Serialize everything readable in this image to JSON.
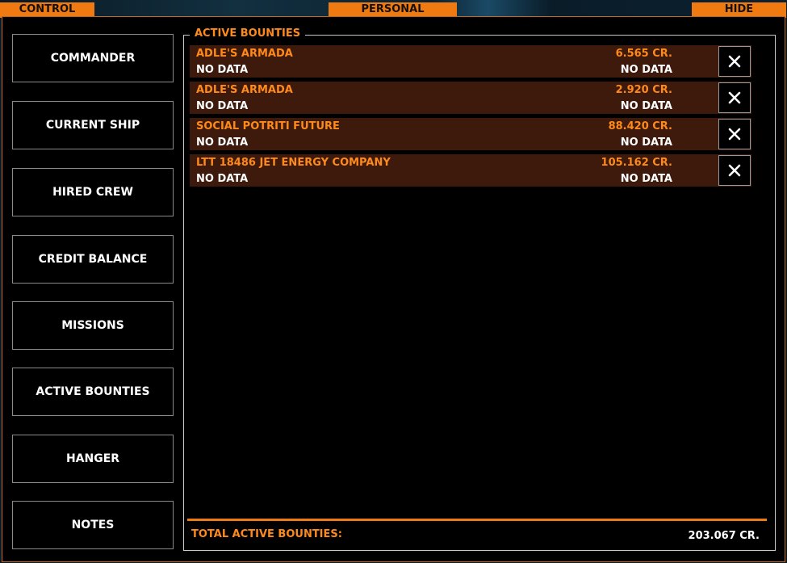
{
  "top_tabs": {
    "control": "CONTROL",
    "personal": "PERSONAL",
    "hide": "HIDE"
  },
  "nav": {
    "items": [
      {
        "label": "COMMANDER"
      },
      {
        "label": "CURRENT SHIP"
      },
      {
        "label": "HIRED CREW"
      },
      {
        "label": "CREDIT BALANCE"
      },
      {
        "label": "MISSIONS"
      },
      {
        "label": "ACTIVE BOUNTIES"
      },
      {
        "label": "HANGER"
      },
      {
        "label": "NOTES"
      }
    ]
  },
  "bounties": {
    "title": "ACTIVE BOUNTIES",
    "rows": [
      {
        "name": "ADLE'S ARMADA",
        "amount": "6.565 CR.",
        "sub_left": "NO DATA",
        "sub_right": "NO DATA"
      },
      {
        "name": "ADLE'S ARMADA",
        "amount": "2.920 CR.",
        "sub_left": "NO DATA",
        "sub_right": "NO DATA"
      },
      {
        "name": "SOCIAL POTRITI FUTURE",
        "amount": "88.420 CR.",
        "sub_left": "NO DATA",
        "sub_right": "NO DATA"
      },
      {
        "name": "LTT 18486 JET ENERGY COMPANY",
        "amount": "105.162 CR.",
        "sub_left": "NO DATA",
        "sub_right": "NO DATA"
      }
    ],
    "total_label": "TOTAL ACTIVE BOUNTIES:",
    "total_value": "203.067 CR."
  },
  "colors": {
    "accent": "#f07a12",
    "row_bg": "#3d1a0c",
    "text_orange": "#ff8a1a"
  },
  "icons": {
    "remove": "close-icon"
  }
}
